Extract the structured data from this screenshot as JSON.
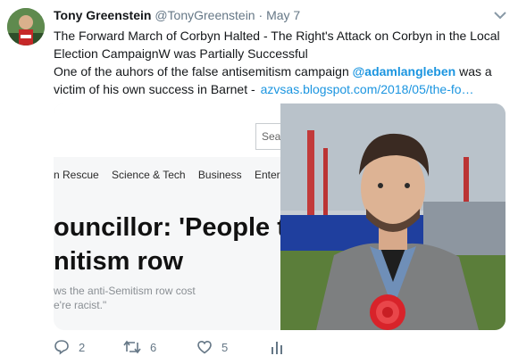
{
  "tweet": {
    "display_name": "Tony Greenstein",
    "handle": "@TonyGreenstein",
    "separator": "·",
    "date": "May 7",
    "line1": "The Forward March of Corbyn Halted - The Right's Attack on Corbyn in the Local",
    "line2": "Election CampaignW was Partially Successful",
    "line3_before_mention": "One of the auhors of the false antisemitism campaign ",
    "mention": "@adamlangleben",
    "line3_after_mention": " was a",
    "line4": "victim of his own success in Barnet -",
    "link": "azvsas.blogspot.com/2018/05/the-fo…"
  },
  "screenshot": {
    "search_text": "Sea",
    "nav_items": [
      "n Rescue",
      "Science & Tech",
      "Business",
      "Enter"
    ],
    "headline_line1": "ouncillor: 'People thi",
    "headline_line2": "nitism row",
    "standfirst_line1": "ws the anti-Semitism row cost",
    "standfirst_line2": "e're racist.\""
  },
  "actions": {
    "reply_count": "2",
    "retweet_count": "6",
    "like_count": "5"
  },
  "colors": {
    "link": "#1b95e0",
    "muted": "#657786",
    "text": "#14171a",
    "rosette": "#d8232a"
  },
  "icons": {
    "caret": "chevron-down-icon",
    "reply": "reply-icon",
    "retweet": "retweet-icon",
    "like": "heart-icon",
    "analytics": "analytics-icon"
  }
}
